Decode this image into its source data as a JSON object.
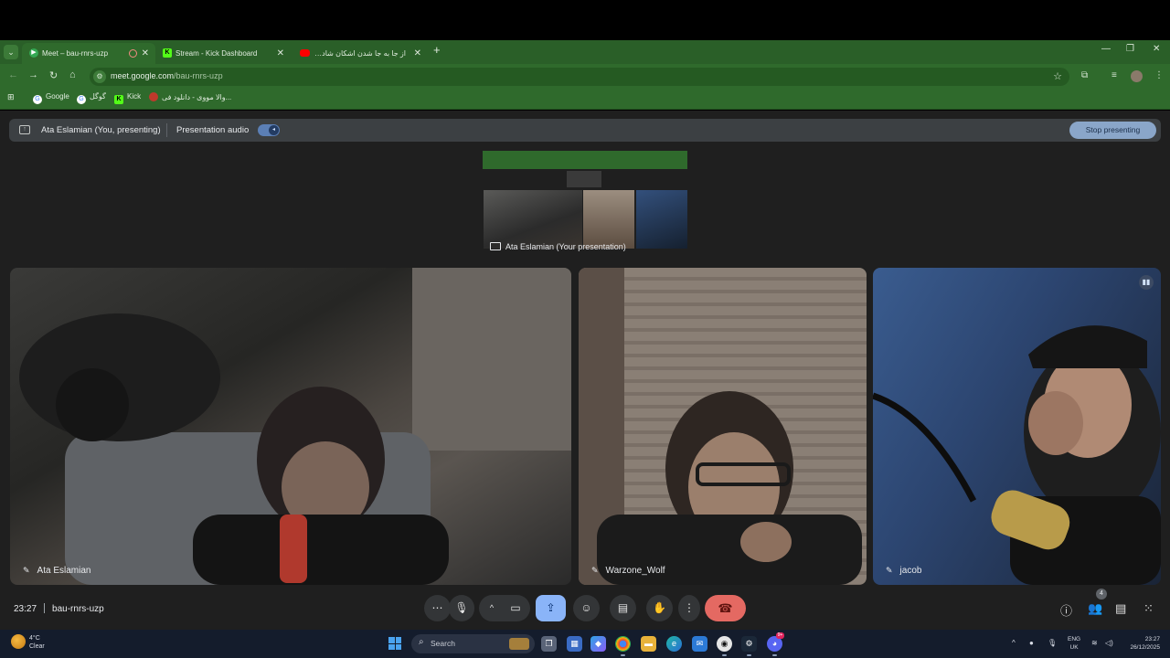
{
  "browser": {
    "tabs": [
      {
        "title": "Meet – bau-rnrs-uzp",
        "active": true
      },
      {
        "title": "Stream - Kick Dashboard",
        "active": false
      },
      {
        "title": "از جا به جا شدن اشکان شادکامی",
        "active": false
      }
    ],
    "url_host": "meet.google.com",
    "url_path": "/bau-rnrs-uzp",
    "bookmarks": [
      "Google",
      "گوگل",
      "Kick",
      "والا مووی - دانلود فی..."
    ]
  },
  "presenting_bar": {
    "presenter": "Ata Eslamian (You, presenting)",
    "audio_label": "Presentation audio",
    "stop_label": "Stop presenting"
  },
  "presentation_thumbnail": {
    "caption": "Ata Eslamian (Your presentation)"
  },
  "participants": [
    {
      "name": "Ata Eslamian"
    },
    {
      "name": "Warzone_Wolf"
    },
    {
      "name": "jacob"
    }
  ],
  "meeting": {
    "time": "23:27",
    "code": "bau-rnrs-uzp",
    "people_count": "4"
  },
  "taskbar": {
    "weather_temp": "4°C",
    "weather_desc": "Clear",
    "search_placeholder": "Search",
    "lang_1": "ENG",
    "lang_2": "UK",
    "time": "23:27",
    "date": "26/12/2025",
    "discord_badge": "9+"
  },
  "colors": {
    "chrome_green": "#2f6a2c",
    "meet_bg": "#1f1f1f",
    "present_active": "#8ab4f8",
    "leave_red": "#e46962"
  },
  "icons": [
    "tab-list-icon",
    "close-icon",
    "new-tab-icon",
    "back-icon",
    "forward-icon",
    "reload-icon",
    "home-icon",
    "star-icon",
    "present-icon",
    "pin-icon",
    "mic-icon",
    "camera-icon",
    "emoji-icon",
    "captions-icon",
    "hand-icon",
    "more-icon",
    "end-call-icon",
    "info-icon",
    "people-icon",
    "chat-icon",
    "activities-icon"
  ]
}
